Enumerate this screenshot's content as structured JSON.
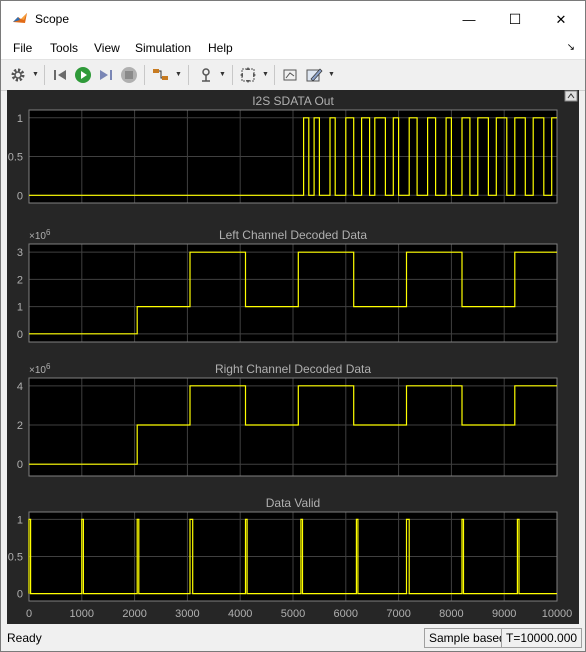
{
  "window": {
    "title": "Scope",
    "minimize_glyph": "—",
    "maximize_glyph": "☐",
    "close_glyph": "✕"
  },
  "menu": [
    "File",
    "Tools",
    "View",
    "Simulation",
    "Help"
  ],
  "toolbar_icons": [
    "gear-icon",
    "step-back-icon",
    "run-icon",
    "step-forward-icon",
    "stop-icon",
    "signal-select-icon",
    "trigger-icon",
    "zoom-axes-icon",
    "style-icon",
    "highlight-icon"
  ],
  "status": {
    "left": "Ready",
    "mode": "Sample based",
    "time": "T=10000.000"
  },
  "colors": {
    "plot_bg": "#000000",
    "figure_bg": "#262626",
    "grid": "#404040",
    "axis_text": "#b0b0b0",
    "signal": "#ffff00"
  },
  "chart_data": [
    {
      "type": "line",
      "title": "I2S SDATA Out",
      "xlim": [
        0,
        10000
      ],
      "ylim": [
        -0.1,
        1.1
      ],
      "yticks": [
        0,
        0.5,
        1
      ],
      "x": [
        0,
        5200,
        5200,
        5300,
        5300,
        5400,
        5400,
        5500,
        5500,
        5700,
        5700,
        5800,
        5800,
        6000,
        6000,
        6150,
        6150,
        6300,
        6300,
        6450,
        6450,
        6550,
        6550,
        6750,
        6750,
        6900,
        6900,
        7000,
        7000,
        7200,
        7200,
        7350,
        7350,
        7550,
        7550,
        7700,
        7700,
        7900,
        7900,
        8000,
        8000,
        8200,
        8200,
        8350,
        8350,
        8500,
        8500,
        8700,
        8700,
        8850,
        8850,
        9050,
        9050,
        9200,
        9200,
        9400,
        9400,
        9550,
        9550,
        9750,
        9750,
        9900,
        9900,
        10000
      ],
      "y": [
        0,
        0,
        1,
        1,
        0,
        0,
        1,
        1,
        0,
        0,
        1,
        1,
        0,
        0,
        1,
        1,
        0,
        0,
        1,
        1,
        0,
        0,
        1,
        1,
        0,
        0,
        1,
        1,
        0,
        0,
        1,
        1,
        0,
        0,
        1,
        1,
        0,
        0,
        1,
        1,
        0,
        0,
        1,
        1,
        0,
        0,
        1,
        1,
        0,
        0,
        1,
        1,
        0,
        0,
        1,
        1,
        0,
        0,
        1,
        1,
        0,
        0,
        1,
        1
      ]
    },
    {
      "type": "line",
      "title": "Left Channel Decoded Data",
      "multiplier": "×10",
      "multiplier_exp": "6",
      "xlim": [
        0,
        10000
      ],
      "ylim": [
        -0.3,
        3.3
      ],
      "yticks": [
        0,
        1,
        2,
        3
      ],
      "x": [
        0,
        2050,
        2050,
        3050,
        3050,
        4100,
        4100,
        5100,
        5100,
        6150,
        6150,
        7150,
        7150,
        8200,
        8200,
        9200,
        9200,
        10000
      ],
      "y": [
        0,
        0,
        1,
        1,
        3,
        3,
        1,
        1,
        3,
        3,
        1,
        1,
        3,
        3,
        1,
        1,
        3,
        3
      ]
    },
    {
      "type": "line",
      "title": "Right Channel Decoded Data",
      "multiplier": "×10",
      "multiplier_exp": "6",
      "xlim": [
        0,
        10000
      ],
      "ylim": [
        -0.6,
        4.4
      ],
      "yticks": [
        0,
        2,
        4
      ],
      "x": [
        0,
        2050,
        2050,
        3050,
        3050,
        4100,
        4100,
        5100,
        5100,
        6150,
        6150,
        7150,
        7150,
        8200,
        8200,
        9200,
        9200,
        10000
      ],
      "y": [
        0,
        0,
        2,
        2,
        4,
        4,
        2,
        2,
        4,
        4,
        2,
        2,
        4,
        4,
        2,
        2,
        4,
        4
      ]
    },
    {
      "type": "line",
      "title": "Data Valid",
      "xlim": [
        0,
        10000
      ],
      "ylim": [
        -0.1,
        1.1
      ],
      "yticks": [
        0,
        0.5,
        1
      ],
      "xticks": [
        0,
        1000,
        2000,
        3000,
        4000,
        5000,
        6000,
        7000,
        8000,
        9000,
        10000
      ],
      "x": [
        0,
        0,
        30,
        30,
        1000,
        1000,
        1030,
        1030,
        2050,
        2050,
        2080,
        2080,
        3050,
        3050,
        3100,
        3100,
        4100,
        4100,
        4130,
        4130,
        5150,
        5150,
        5180,
        5180,
        6200,
        6200,
        6230,
        6230,
        7150,
        7150,
        7200,
        7200,
        8200,
        8200,
        8230,
        8230,
        9250,
        9250,
        9280,
        9280,
        10000
      ],
      "y": [
        0,
        1,
        1,
        0,
        0,
        1,
        1,
        0,
        0,
        1,
        1,
        0,
        0,
        1,
        1,
        0,
        0,
        1,
        1,
        0,
        0,
        1,
        1,
        0,
        0,
        1,
        1,
        0,
        0,
        1,
        1,
        0,
        0,
        1,
        1,
        0,
        0,
        1,
        1,
        0,
        0
      ]
    }
  ]
}
